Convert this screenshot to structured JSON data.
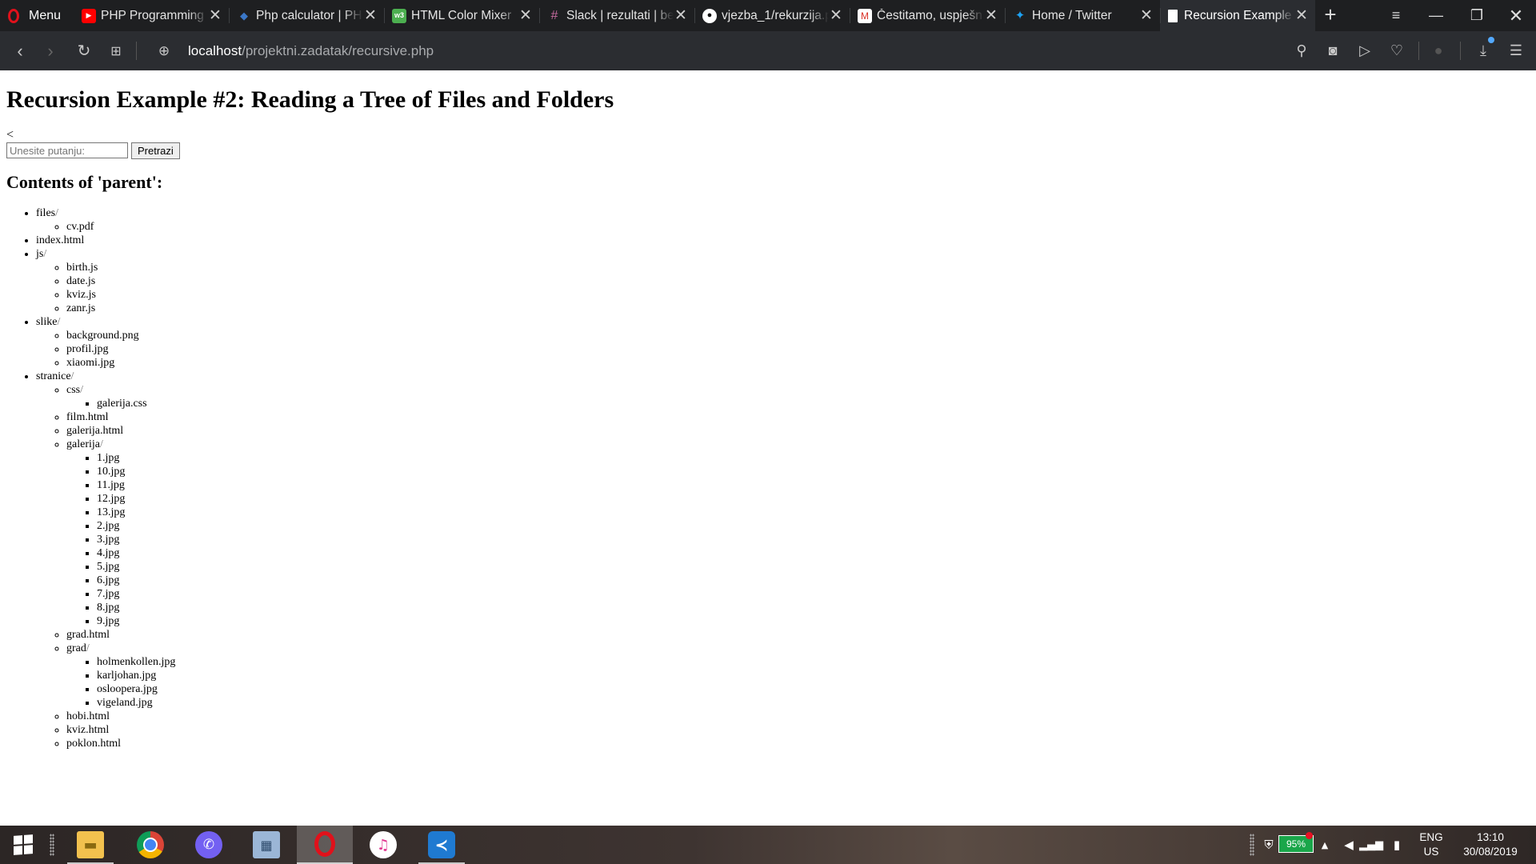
{
  "browser": {
    "menu_label": "Menu",
    "tabs": [
      {
        "title": "PHP Programming",
        "icon": "youtube-icon"
      },
      {
        "title": "Php calculator | PHP",
        "icon": "php-icon"
      },
      {
        "title": "HTML Color Mixer",
        "icon": "w3schools-icon"
      },
      {
        "title": "Slack | rezultati | be",
        "icon": "slack-icon"
      },
      {
        "title": "vjezba_1/rekurzija.p",
        "icon": "github-icon"
      },
      {
        "title": "Čestitamo, uspješn",
        "icon": "gmail-icon"
      },
      {
        "title": "Home / Twitter",
        "icon": "twitter-icon"
      },
      {
        "title": "Recursion Example",
        "icon": "document-icon",
        "active": true
      }
    ],
    "url": {
      "host": "localhost",
      "path": "/projektni.zadatak/recursive.php"
    }
  },
  "page": {
    "title": "Recursion Example #2: Reading a Tree of Files and Folders",
    "stray_text": "<",
    "search": {
      "placeholder": "Unesite putanju:",
      "value": "",
      "button_label": "Pretrazi"
    },
    "contents_heading": "Contents of 'parent':",
    "tree": [
      {
        "name": "files",
        "dir": true,
        "children": [
          {
            "name": "cv.pdf"
          }
        ]
      },
      {
        "name": "index.html"
      },
      {
        "name": "js",
        "dir": true,
        "children": [
          {
            "name": "birth.js"
          },
          {
            "name": "date.js"
          },
          {
            "name": "kviz.js"
          },
          {
            "name": "zanr.js"
          }
        ]
      },
      {
        "name": "slike",
        "dir": true,
        "children": [
          {
            "name": "background.png"
          },
          {
            "name": "profil.jpg"
          },
          {
            "name": "xiaomi.jpg"
          }
        ]
      },
      {
        "name": "stranice",
        "dir": true,
        "children": [
          {
            "name": "css",
            "dir": true,
            "children": [
              {
                "name": "galerija.css"
              }
            ]
          },
          {
            "name": "film.html"
          },
          {
            "name": "galerija.html"
          },
          {
            "name": "galerija",
            "dir": true,
            "children": [
              {
                "name": "1.jpg"
              },
              {
                "name": "10.jpg"
              },
              {
                "name": "11.jpg"
              },
              {
                "name": "12.jpg"
              },
              {
                "name": "13.jpg"
              },
              {
                "name": "2.jpg"
              },
              {
                "name": "3.jpg"
              },
              {
                "name": "4.jpg"
              },
              {
                "name": "5.jpg"
              },
              {
                "name": "6.jpg"
              },
              {
                "name": "7.jpg"
              },
              {
                "name": "8.jpg"
              },
              {
                "name": "9.jpg"
              }
            ]
          },
          {
            "name": "grad.html"
          },
          {
            "name": "grad",
            "dir": true,
            "children": [
              {
                "name": "holmenkollen.jpg"
              },
              {
                "name": "karljohan.jpg"
              },
              {
                "name": "osloopera.jpg"
              },
              {
                "name": "vigeland.jpg"
              }
            ]
          },
          {
            "name": "hobi.html"
          },
          {
            "name": "kviz.html"
          },
          {
            "name": "poklon.html"
          }
        ]
      }
    ]
  },
  "taskbar": {
    "apps": [
      {
        "name": "file-explorer",
        "icon": "folder-icon"
      },
      {
        "name": "chrome",
        "icon": "chrome-icon"
      },
      {
        "name": "viber",
        "icon": "viber-icon"
      },
      {
        "name": "calculator",
        "icon": "calculator-icon"
      },
      {
        "name": "opera",
        "icon": "opera-icon",
        "active": true
      },
      {
        "name": "itunes",
        "icon": "itunes-icon"
      },
      {
        "name": "vscode",
        "icon": "vscode-icon"
      }
    ],
    "battery": "95%",
    "lang_top": "ENG",
    "lang_bottom": "US",
    "time": "13:10",
    "date": "30/08/2019"
  },
  "colors": {
    "tabbar_bg": "#1e1f21",
    "addressbar_bg": "#2b2d31",
    "opera_red": "#e0111b",
    "battery_green": "#1aa64a"
  }
}
